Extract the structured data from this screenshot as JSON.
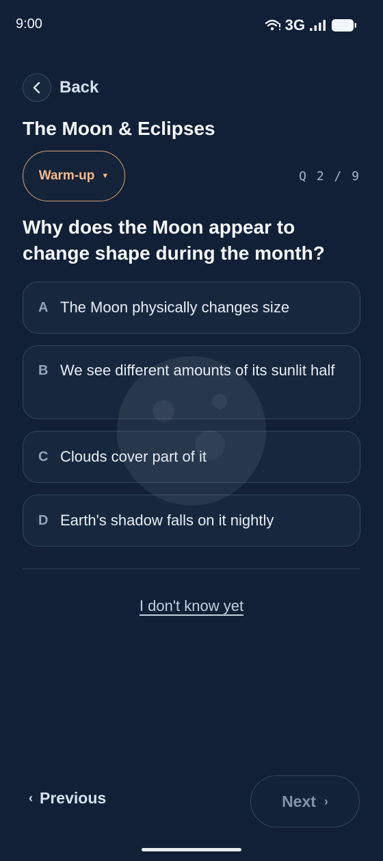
{
  "status_bar": {
    "time": "9:00",
    "network": "3G"
  },
  "nav": {
    "back_label": "Back"
  },
  "quiz": {
    "title": "The Moon & Eclipses",
    "level": "Warm-up",
    "counter": "Q 2 / 9"
  },
  "question": {
    "text": "Why does the Moon appear to change shape during the month?",
    "options": [
      {
        "letter": "A",
        "text": "The Moon physically changes size"
      },
      {
        "letter": "B",
        "text": "We see different amounts of its sunlit half"
      },
      {
        "letter": "C",
        "text": "Clouds cover part of it"
      },
      {
        "letter": "D",
        "text": "Earth's shadow falls on it nightly"
      }
    ]
  },
  "dont_know_label": "I don't know yet",
  "footer": {
    "previous_label": "Previous",
    "next_label": "Next"
  },
  "icons": {
    "back": "chevron-left-icon",
    "wifi": "wifi-icon",
    "signal": "signal-bars-icon",
    "battery": "battery-icon",
    "dropdown": "caret-down-icon",
    "moon": "moon-icon"
  },
  "colors": {
    "background": "#112036",
    "accent": "#f3b98c",
    "option_border": "#34465e"
  }
}
